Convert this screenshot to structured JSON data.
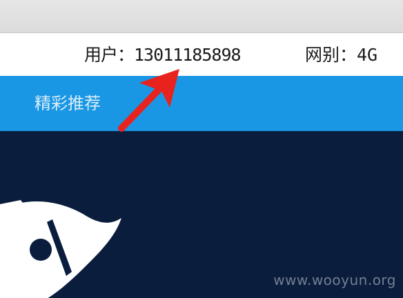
{
  "header": {
    "user_info": "用户：13011185898",
    "network_info": "网别：4G"
  },
  "nav": {
    "featured_tab": "精彩推荐"
  },
  "watermark": "www.wooyun.org",
  "colors": {
    "nav_bar": "#1997e5",
    "main_background": "#0a1d3d",
    "annotation_arrow": "#e8231d"
  },
  "icons": {
    "rocket": "rocket-icon",
    "annotation": "red-arrow"
  }
}
